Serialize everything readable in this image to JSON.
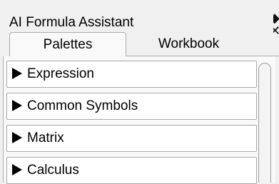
{
  "window": {
    "title": "AI Formula Assistant"
  },
  "tabs": [
    {
      "label": "Palettes",
      "active": true
    },
    {
      "label": "Workbook",
      "active": false
    }
  ],
  "sections": [
    {
      "label": "Expression",
      "expanded": false
    },
    {
      "label": "Common Symbols",
      "expanded": false
    },
    {
      "label": "Matrix",
      "expanded": false
    },
    {
      "label": "Calculus",
      "expanded": false
    }
  ],
  "icons": {
    "collapsed": "triangle-right-icon",
    "top_controls": "window-controls-icon"
  },
  "colors": {
    "background": "#f0f0f0",
    "section_background": "#ffffff",
    "border": "#adadad"
  }
}
